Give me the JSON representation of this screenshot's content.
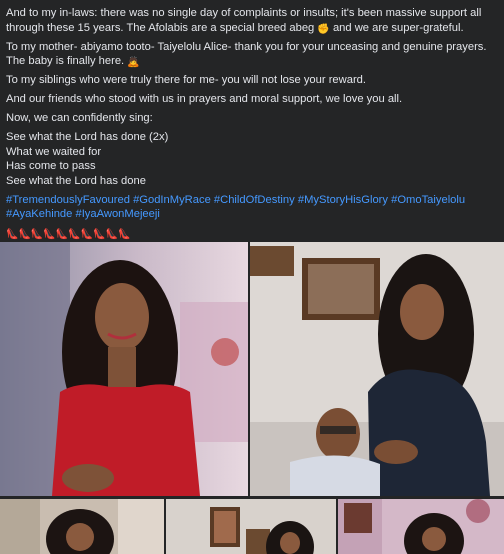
{
  "post": {
    "paragraphs": [
      {
        "text": "And to my in-laws: there was no single day of complaints or insults; it's been massive support all through these 15 years. The Afolabis are a special breed abeg ",
        "emoji": "fist-bump-icon",
        "emoji_char": "✊",
        "tail": " and we are super-grateful."
      },
      {
        "text": "To my mother- abiyamo tooto- Taiyelolu Alice- thank you for your unceasing and genuine prayers. The baby is finally here. ",
        "emoji": "praying-person-icon",
        "emoji_char": "🙇",
        "tail": ""
      },
      {
        "text": "To my siblings who were truly there for me- you will not lose your reward."
      },
      {
        "text": "And our friends who stood with us in prayers and moral support, we love you all."
      },
      {
        "text": "Now, we can confidently sing:"
      }
    ],
    "song_lines": [
      "See what the Lord has done (2x)",
      "What we waited for",
      "Has come to pass",
      "See what the Lord has done"
    ],
    "hashtags": [
      "#TremendouslyFavoured",
      "#GodInMyRace",
      "#ChildOfDestiny",
      "#MyStoryHisGlory",
      "#OmoTaiyelolu",
      "#AyaKehinde",
      "#IyaAwonMejeeji"
    ],
    "reaction_icon": "high-heel-shoe-icon",
    "reaction_char": "👠",
    "reaction_count": 10
  },
  "photos": [
    {
      "name": "photo-woman-red-top",
      "icon": "photo-icon"
    },
    {
      "name": "photo-couple-maternity",
      "icon": "photo-icon"
    },
    {
      "name": "photo-thumb-3",
      "icon": "photo-icon"
    },
    {
      "name": "photo-thumb-4",
      "icon": "photo-icon"
    },
    {
      "name": "photo-thumb-5",
      "icon": "photo-icon"
    }
  ],
  "colors": {
    "background": "#242526",
    "text": "#e4e6eb",
    "hashtag": "#4599ff"
  }
}
